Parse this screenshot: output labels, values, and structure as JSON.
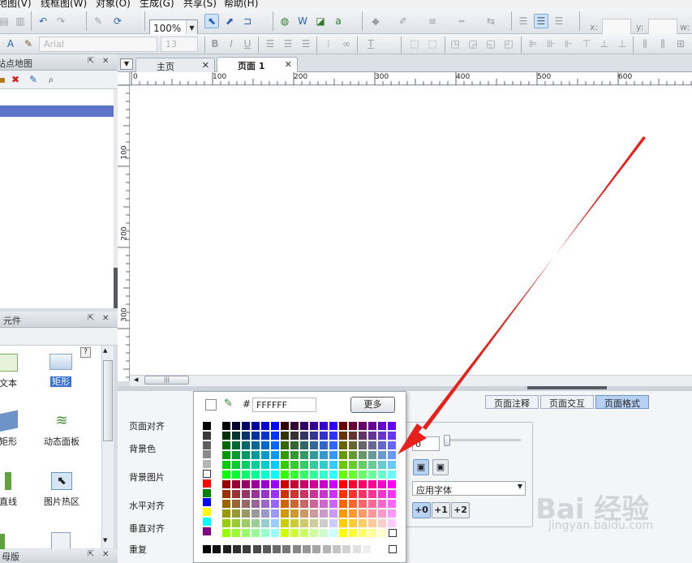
{
  "menubar": {
    "items": [
      "地图(V)",
      "线框图(W)",
      "对象(O)",
      "生成(G)",
      "共享(S)",
      "帮助(H)"
    ]
  },
  "toolbar": {
    "zoom_value": "100%",
    "x_label": "x:",
    "y_label": "y:",
    "w_label": "w:",
    "font_name": "Arial",
    "font_size": "13",
    "bold": "B",
    "italic": "I",
    "underline": "U"
  },
  "left_panel_top": {
    "title": "站点地图"
  },
  "left_panel_widgets": {
    "title": "元件",
    "help": "?",
    "items": [
      "文本",
      "矩形",
      "矩形",
      "动态面板",
      "直线",
      "图片热区"
    ]
  },
  "left_panel_bottom": {
    "title": "母版"
  },
  "tabs": [
    {
      "label": "主页"
    },
    {
      "label": "页面 1"
    }
  ],
  "ruler": {
    "top_ticks": [
      "0",
      "100",
      "200",
      "300",
      "400",
      "500",
      "600"
    ],
    "left_ticks": [
      "100",
      "200",
      "300"
    ]
  },
  "bottom_tabs": [
    {
      "label": "页面注释"
    },
    {
      "label": "页面交互"
    },
    {
      "label": "页面格式"
    }
  ],
  "format": {
    "labels": [
      "页面对齐",
      "背景色",
      "背景图片",
      "水平对齐",
      "垂直对齐",
      "重复"
    ],
    "value": "0",
    "font_select": "应用字体",
    "size_buttons": [
      "+0",
      "+1",
      "+2"
    ]
  },
  "color_picker": {
    "hash": "#",
    "hex": "FFFFFF",
    "more": "更多"
  },
  "watermark": {
    "brand": "Bai 经验",
    "url": "jingyan.baidu.com"
  },
  "colors": {
    "annotation_arrow": "#e8201c",
    "selection": "#5d74c9",
    "active_tab": "#b5d0f1"
  }
}
